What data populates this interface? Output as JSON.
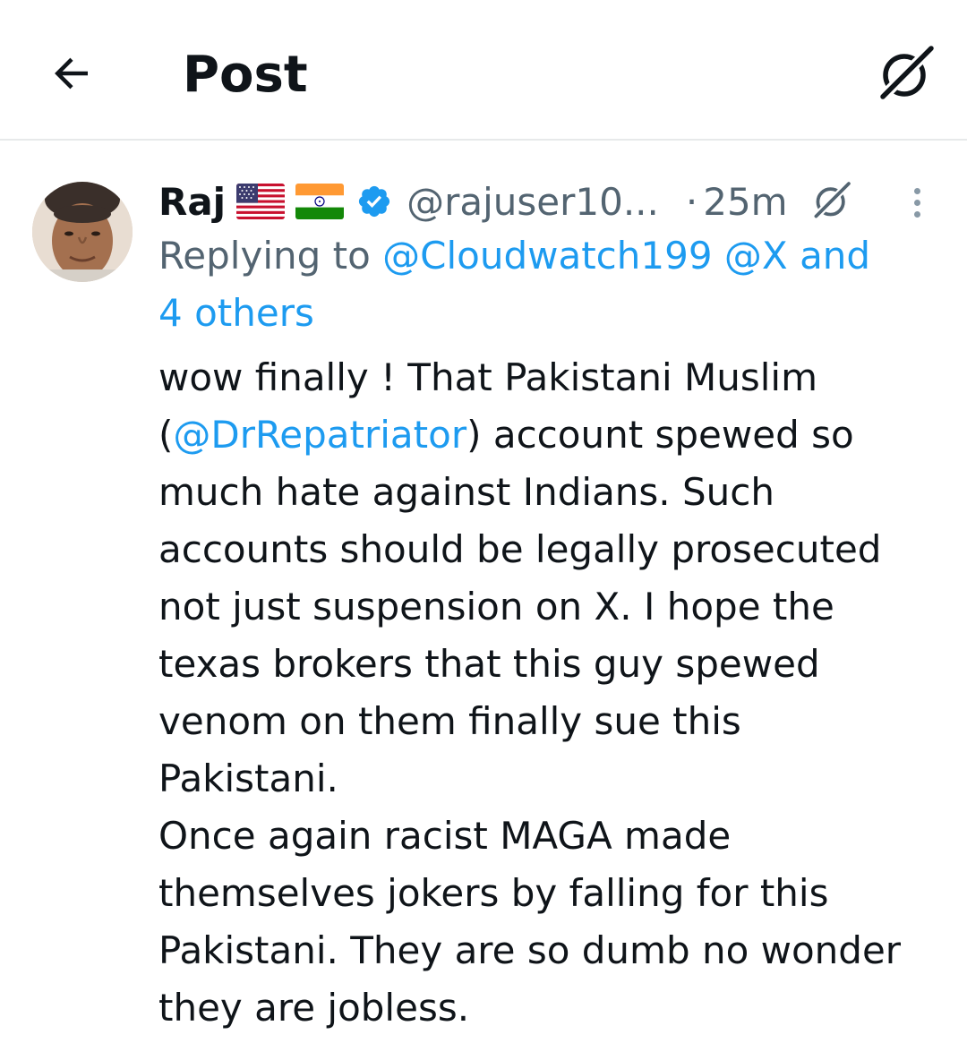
{
  "header": {
    "title": "Post",
    "back_icon": "arrow-left-icon",
    "grok_icon": "grok-icon"
  },
  "post": {
    "author": {
      "display_name": "Raj",
      "flags": [
        "us-flag-icon",
        "india-flag-icon"
      ],
      "verified": true,
      "handle": "@rajuser10...",
      "separator": "·",
      "time": "25m"
    },
    "replying": {
      "prefix": "Replying to",
      "mentions": [
        "@Cloudwatch199",
        "@X"
      ],
      "and_label": "and",
      "others": "4 others"
    },
    "text": {
      "line1": "wow finally ! That Pakistani  Muslim",
      "line2_open": "(",
      "line2_mention": "@DrRepatriator",
      "line2_rest": ") account spewed so",
      "line3": "much hate against Indians. Such",
      "line4": "accounts should be legally prosecuted",
      "line5": "not just suspension on X. I hope the",
      "line6": "texas brokers that this guy spewed",
      "line7": "venom on them finally sue this",
      "line8": "Pakistani.",
      "line9": "Once again racist MAGA made",
      "line10": "themselves jokers by falling for this",
      "line11": "Pakistani. They are so dumb no wonder",
      "line12": "they are jobless."
    }
  },
  "colors": {
    "link": "#1d9bf0",
    "secondary_text": "#536471",
    "primary_text": "#0f1419",
    "divider": "#e7e9ea",
    "verified": "#1d9bf0"
  }
}
